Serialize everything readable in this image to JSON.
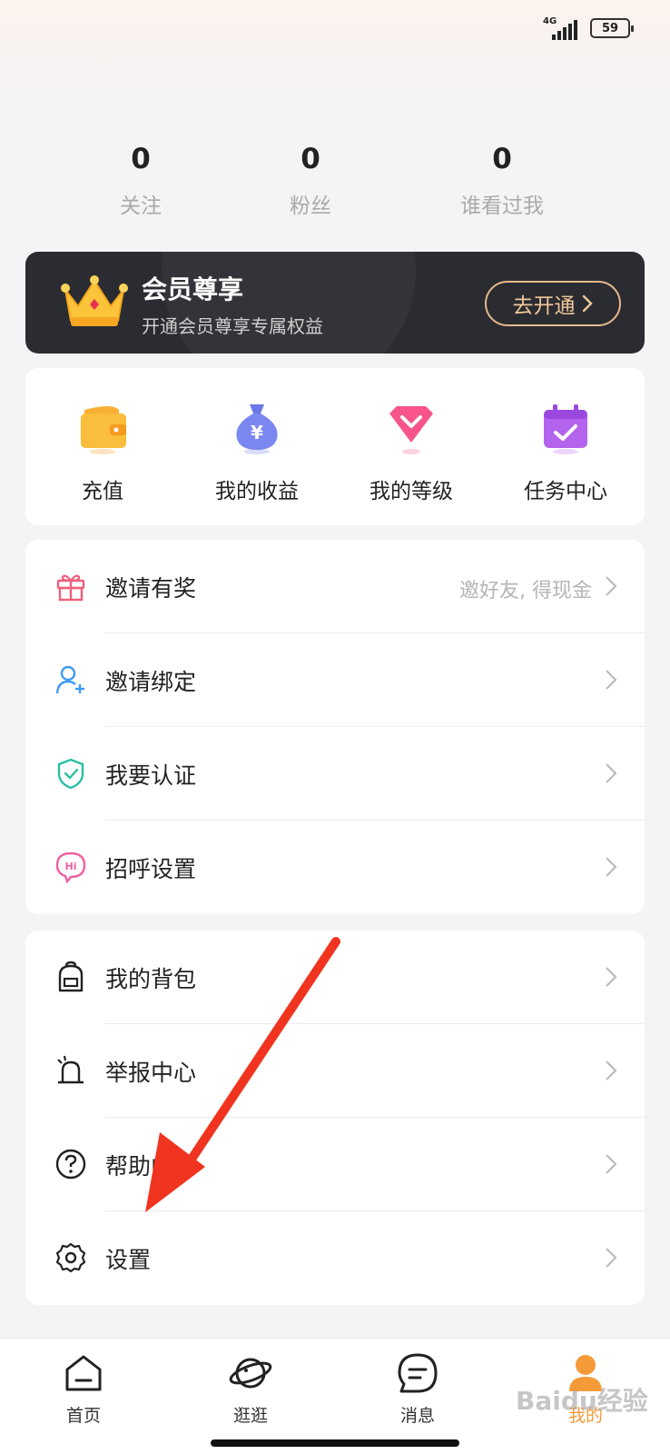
{
  "status_bar": {
    "network": "4G",
    "battery": "59"
  },
  "stats": [
    {
      "value": "0",
      "label": "关注"
    },
    {
      "value": "0",
      "label": "粉丝"
    },
    {
      "value": "0",
      "label": "谁看过我"
    }
  ],
  "vip": {
    "title": "会员尊享",
    "subtitle": "开通会员尊享专属权益",
    "button": "去开通"
  },
  "quick": [
    {
      "label": "充值",
      "icon": "wallet-icon"
    },
    {
      "label": "我的收益",
      "icon": "money-bag-icon"
    },
    {
      "label": "我的等级",
      "icon": "diamond-icon"
    },
    {
      "label": "任务中心",
      "icon": "calendar-check-icon"
    }
  ],
  "menu1": [
    {
      "label": "邀请有奖",
      "hint": "邀好友, 得现金",
      "icon": "gift-icon"
    },
    {
      "label": "邀请绑定",
      "hint": "",
      "icon": "add-user-icon"
    },
    {
      "label": "我要认证",
      "hint": "",
      "icon": "shield-check-icon"
    },
    {
      "label": "招呼设置",
      "hint": "",
      "icon": "hi-bubble-icon"
    }
  ],
  "menu2": [
    {
      "label": "我的背包",
      "icon": "backpack-icon"
    },
    {
      "label": "举报中心",
      "icon": "alarm-icon"
    },
    {
      "label": "帮助中心",
      "icon": "help-icon"
    },
    {
      "label": "设置",
      "icon": "gear-icon"
    }
  ],
  "tabs": [
    {
      "label": "首页",
      "icon": "home-icon"
    },
    {
      "label": "逛逛",
      "icon": "planet-icon"
    },
    {
      "label": "消息",
      "icon": "message-icon"
    },
    {
      "label": "我的",
      "icon": "profile-icon",
      "active": true
    }
  ],
  "watermark": "Baidu经验",
  "colors": {
    "accent": "#f59a38",
    "vip_bg": "#2b2c31",
    "vip_gold": "#e6b98c",
    "annotation_arrow": "#f0341f"
  }
}
